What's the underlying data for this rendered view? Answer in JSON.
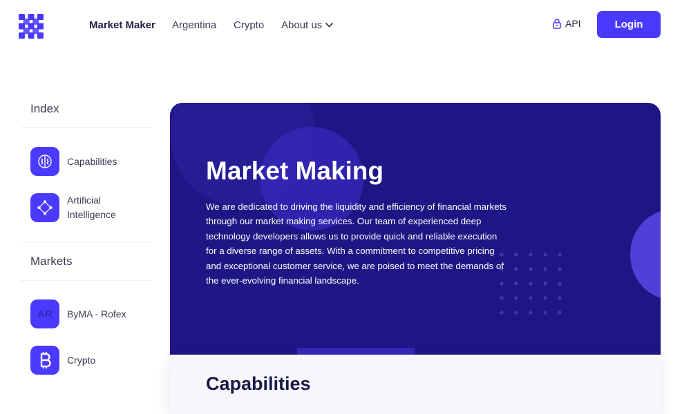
{
  "brand": {
    "logo_icon": "lattice-logo-icon",
    "accent": "#4a3aff",
    "hero_bg": "#1f1685"
  },
  "nav": {
    "items": [
      {
        "label": "Market Maker",
        "active": true
      },
      {
        "label": "Argentina"
      },
      {
        "label": "Crypto"
      },
      {
        "label": "About us",
        "dropdown": true
      }
    ]
  },
  "header": {
    "api_label": "API",
    "api_icon": "lock-icon",
    "login_label": "Login"
  },
  "sidebar": {
    "index_heading": "Index",
    "index_items": [
      {
        "label": "Capabilities",
        "icon": "brain-icon"
      },
      {
        "label": "Artificial Intelligence",
        "icon": "network-icon"
      }
    ],
    "markets_heading": "Markets",
    "market_items": [
      {
        "label": "ByMA - Rofex",
        "icon_text": "AR"
      },
      {
        "label": "Crypto",
        "icon": "bitcoin-icon"
      }
    ]
  },
  "hero": {
    "title": "Market Making",
    "text": "We are dedicated to driving the liquidity and efficiency of financial markets through our market making services. Our team of experienced deep technology developers allows us to provide quick and reliable execution for a diverse range of assets. With a commitment to competitive pricing and exceptional customer service, we are poised to meet the demands of the ever-evolving financial landscape."
  },
  "capabilities": {
    "title": "Capabilities"
  }
}
